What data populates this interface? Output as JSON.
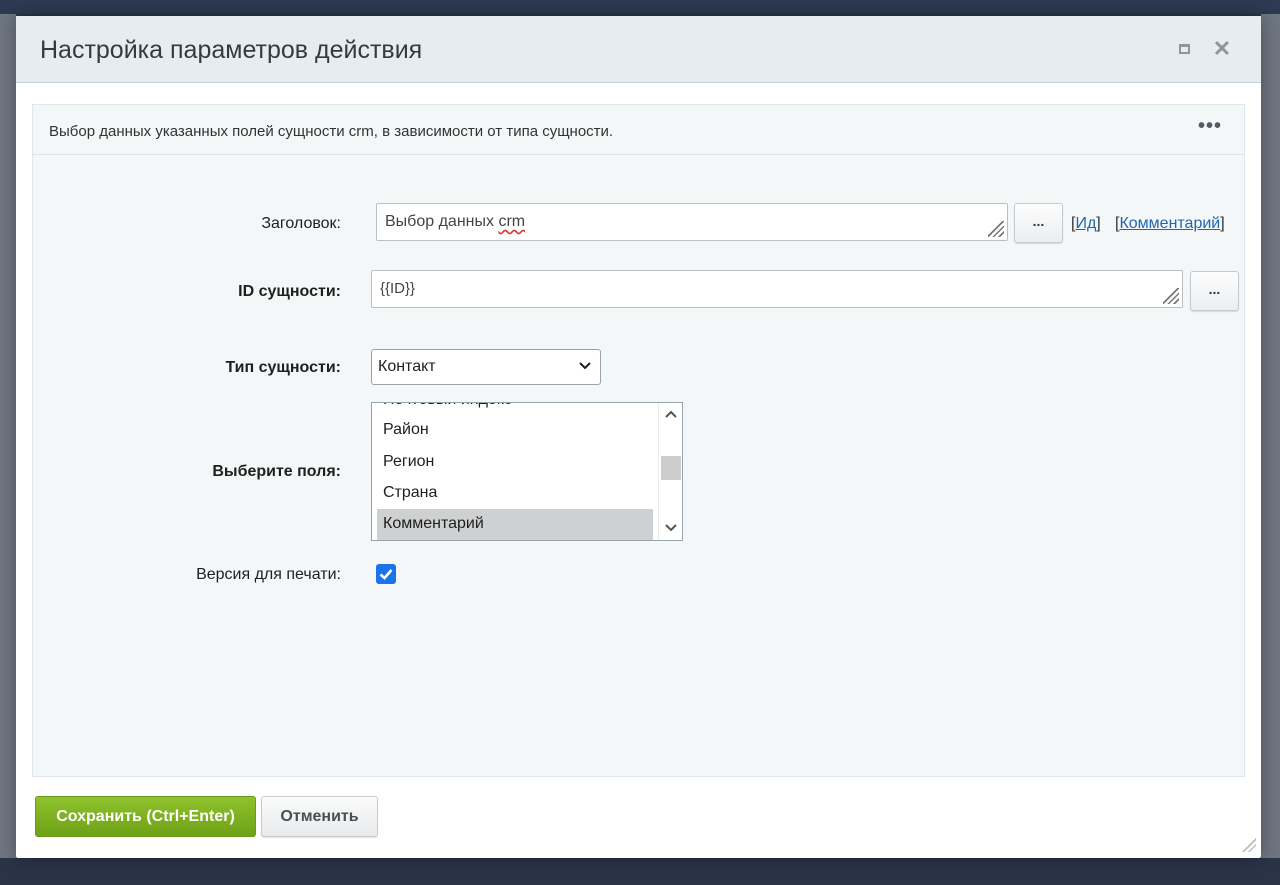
{
  "dialog": {
    "title": "Настройка параметров действия",
    "maximize_icon": "maximize-icon",
    "close_icon": "close-icon",
    "close_glyph": "✕"
  },
  "panel": {
    "description": "Выбор данных указанных полей сущности crm, в зависимости от типа сущности.",
    "more_glyph": "•••"
  },
  "form": {
    "title": {
      "label": "Заголовок:",
      "value_prefix": "Выбор данных ",
      "value_misspelled": "crm",
      "dots_label": "...",
      "id_link_open": "[",
      "id_link": "Ид",
      "id_link_close": "]",
      "comment_link_open": "[",
      "comment_link": "Комментарий",
      "comment_link_close": "]"
    },
    "entity_id": {
      "label": "ID сущности:",
      "value": "{{ID}}",
      "dots_label": "..."
    },
    "entity_type": {
      "label": "Тип сущности:",
      "selected": "Контакт"
    },
    "fields": {
      "label": "Выберите поля:",
      "items": [
        {
          "label": "Почтовый индекс",
          "selected": false
        },
        {
          "label": "Район",
          "selected": false
        },
        {
          "label": "Регион",
          "selected": false
        },
        {
          "label": "Страна",
          "selected": false
        },
        {
          "label": "Комментарий",
          "selected": true
        }
      ]
    },
    "print_version": {
      "label": "Версия для печати:",
      "checked": true
    }
  },
  "footer": {
    "save_label": "Сохранить (Ctrl+Enter)",
    "cancel_label": "Отменить"
  },
  "colors": {
    "save_button": "#7cb11f",
    "link": "#2067b0",
    "checkbox": "#1a73e8",
    "header_bg": "#e6ecef",
    "panel_bg": "#f4f7f8"
  }
}
